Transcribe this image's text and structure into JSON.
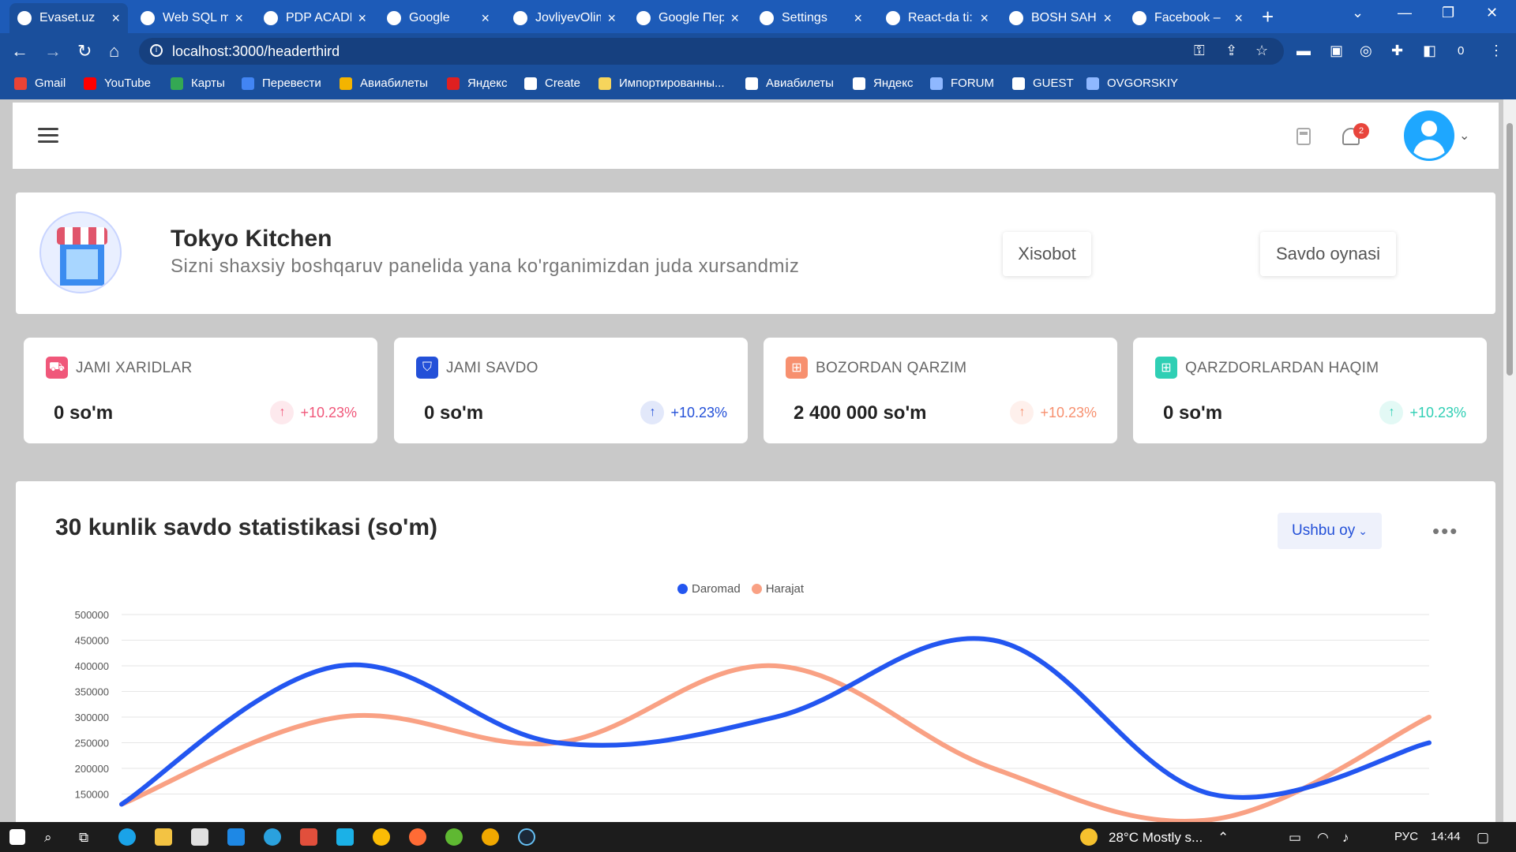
{
  "browser": {
    "tabs": [
      {
        "label": "Evaset.uz",
        "active": true,
        "favicon": "evo"
      },
      {
        "label": "Web SQL m",
        "favicon": "chrome"
      },
      {
        "label": "PDP ACADE",
        "favicon": "pdp"
      },
      {
        "label": "Google",
        "favicon": "google"
      },
      {
        "label": "JovliyevOlim",
        "favicon": "github"
      },
      {
        "label": "Google Пер",
        "favicon": "translate"
      },
      {
        "label": "Settings",
        "favicon": "gear"
      },
      {
        "label": "React-da ti:",
        "favicon": "react"
      },
      {
        "label": "BOSH SAHI",
        "favicon": "globe"
      },
      {
        "label": "Facebook –",
        "favicon": "facebook"
      }
    ],
    "url": "localhost:3000/headerthird",
    "profile_count": "0",
    "bookmarks": [
      {
        "label": "Gmail",
        "color": "#ea4335"
      },
      {
        "label": "YouTube",
        "color": "#ff0000"
      },
      {
        "label": "Карты",
        "color": "#34a853"
      },
      {
        "label": "Перевести",
        "color": "#4285f4"
      },
      {
        "label": "Авиабилеты",
        "color": "#f4b400"
      },
      {
        "label": "Яндекс",
        "color": "#e02020"
      },
      {
        "label": "Create",
        "color": "#ffffff"
      },
      {
        "label": "Импортированны...",
        "color": "#f6d55c"
      },
      {
        "label": "Авиабилеты",
        "color": "#ffffff"
      },
      {
        "label": "Яндекс",
        "color": "#ffffff"
      },
      {
        "label": "FORUM",
        "color": "#8fb8ff"
      },
      {
        "label": "GUEST",
        "color": "#ffffff"
      },
      {
        "label": "OVGORSKIY",
        "color": "#8fb8ff"
      }
    ]
  },
  "header": {
    "notification_count": "2"
  },
  "welcome": {
    "title": "Tokyo Kitchen",
    "subtitle": "Sizni shaxsiy boshqaruv panelida yana ko'rganimizdan juda xursandmiz",
    "report_button": "Xisobot",
    "sales_button": "Savdo oynasi"
  },
  "stats": [
    {
      "label": "JAMI XARIDLAR",
      "value": "0 so'm",
      "trend": "+10.23%",
      "color": "#f0577a",
      "icon": "cart-icon"
    },
    {
      "label": "JAMI SAVDO",
      "value": "0 so'm",
      "trend": "+10.23%",
      "color": "#2350d8",
      "icon": "basket-icon"
    },
    {
      "label": "BOZORDAN QARZIM",
      "value": "2 400 000 so'm",
      "trend": "+10.23%",
      "color": "#f7906f",
      "icon": "bag-icon"
    },
    {
      "label": "QARZDORLARDAN HAQIM",
      "value": "0 so'm",
      "trend": "+10.23%",
      "color": "#2fcfb4",
      "icon": "bag-icon"
    }
  ],
  "chart_card": {
    "title": "30 kunlik savdo statistikasi (so'm)",
    "period_select": "Ushbu oy",
    "more_label": "•••"
  },
  "chart_data": {
    "type": "line",
    "ylim": [
      150000,
      500000
    ],
    "yticks": [
      "500000",
      "450000",
      "400000",
      "350000",
      "300000",
      "250000",
      "200000",
      "150000"
    ],
    "series": [
      {
        "name": "Daromad",
        "color": "#2356f0",
        "points": [
          [
            0,
            130000
          ],
          [
            1,
            400000
          ],
          [
            2,
            250000
          ],
          [
            3,
            300000
          ],
          [
            4,
            450000
          ],
          [
            5,
            150000
          ],
          [
            6,
            250000
          ]
        ]
      },
      {
        "name": "Harajat",
        "color": "#f9a184",
        "points": [
          [
            0,
            130000
          ],
          [
            1,
            300000
          ],
          [
            2,
            250000
          ],
          [
            3,
            400000
          ],
          [
            4,
            200000
          ],
          [
            5,
            100000
          ],
          [
            6,
            300000
          ]
        ]
      }
    ],
    "legend": "top-center",
    "grid": true
  },
  "taskbar": {
    "weather": "28°C  Mostly s...",
    "language": "РУС",
    "time": "14:44"
  }
}
